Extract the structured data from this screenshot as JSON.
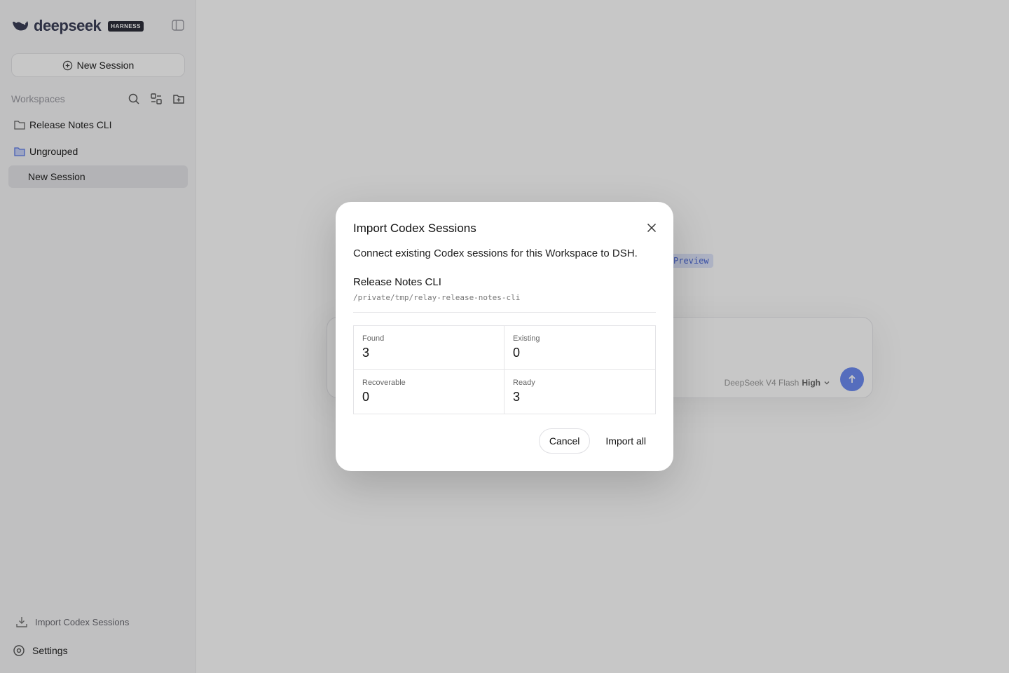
{
  "sidebar": {
    "brand": {
      "name": "deepseek",
      "badge": "HARNESS"
    },
    "new_session_label": "New Session",
    "workspaces_label": "Workspaces",
    "workspaces": [
      {
        "label": "Release Notes CLI"
      },
      {
        "label": "Ungrouped"
      }
    ],
    "active_session_label": "New Session",
    "footer": {
      "import_label": "Import Codex Sessions",
      "settings_label": "Settings"
    }
  },
  "main": {
    "preview_chip": "Preview",
    "composer": {
      "model_label": "DeepSeek V4 Flash",
      "effort_label": "High"
    }
  },
  "modal": {
    "title": "Import Codex Sessions",
    "description": "Connect existing Codex sessions for this Workspace to DSH.",
    "workspace_name": "Release Notes CLI",
    "workspace_path": "/private/tmp/relay-release-notes-cli",
    "stats": [
      {
        "label": "Found",
        "value": "3"
      },
      {
        "label": "Existing",
        "value": "0"
      },
      {
        "label": "Recoverable",
        "value": "0"
      },
      {
        "label": "Ready",
        "value": "3"
      }
    ],
    "cancel_label": "Cancel",
    "import_label": "Import all"
  },
  "colors": {
    "accent": "#6d8cf2",
    "overlay": "rgba(0,0,0,0.22)"
  }
}
